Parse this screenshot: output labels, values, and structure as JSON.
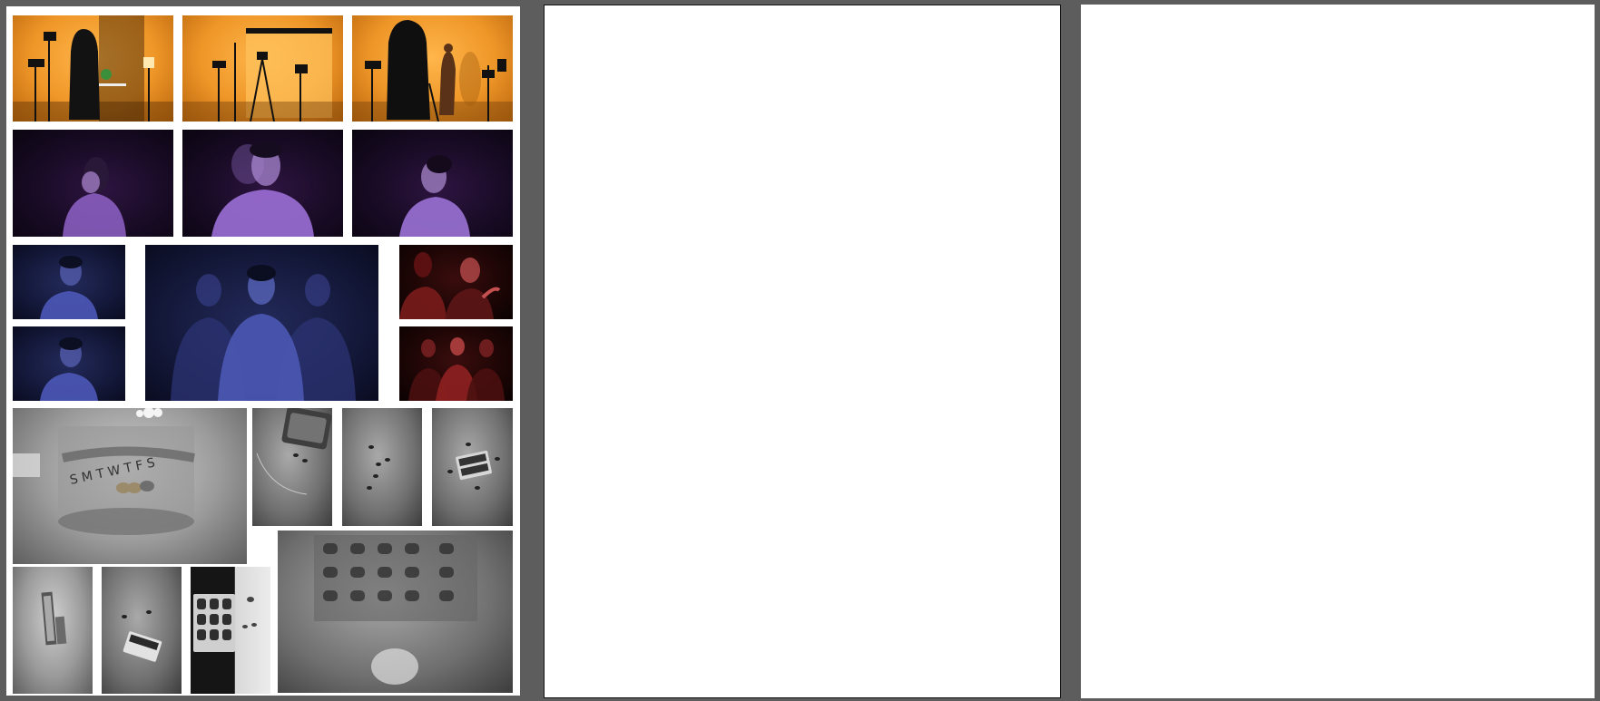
{
  "viewer": {
    "pages": [
      {
        "id": "page-1",
        "thumbnails": [
          {
            "name": "photo-studio-orange-1",
            "icon": "photo-icon"
          },
          {
            "name": "photo-studio-orange-2",
            "icon": "photo-icon"
          },
          {
            "name": "photo-studio-orange-3",
            "icon": "photo-icon"
          },
          {
            "name": "photo-portrait-purple-1",
            "icon": "photo-icon"
          },
          {
            "name": "photo-portrait-purple-2",
            "icon": "photo-icon"
          },
          {
            "name": "photo-portrait-purple-3",
            "icon": "photo-icon"
          },
          {
            "name": "photo-portrait-blue-small-1",
            "icon": "photo-icon"
          },
          {
            "name": "photo-portrait-blue-small-2",
            "icon": "photo-icon"
          },
          {
            "name": "photo-portrait-blue-triple",
            "icon": "photo-icon"
          },
          {
            "name": "photo-portrait-red-1",
            "icon": "photo-icon"
          },
          {
            "name": "photo-portrait-red-2",
            "icon": "photo-icon"
          },
          {
            "name": "photo-pill-organizer-large",
            "icon": "photo-icon"
          },
          {
            "name": "photo-pills-1",
            "icon": "photo-icon"
          },
          {
            "name": "photo-pills-2",
            "icon": "photo-icon"
          },
          {
            "name": "photo-pills-3",
            "icon": "photo-icon"
          },
          {
            "name": "photo-blister-pack-blur",
            "icon": "photo-icon"
          },
          {
            "name": "photo-pills-4",
            "icon": "photo-icon"
          },
          {
            "name": "photo-pills-5",
            "icon": "photo-icon"
          },
          {
            "name": "photo-pills-6",
            "icon": "photo-icon"
          }
        ]
      },
      {
        "id": "page-2",
        "thumbnails": []
      },
      {
        "id": "page-3",
        "thumbnails": []
      }
    ]
  },
  "colors": {
    "background": "#5d5d5d",
    "page": "#ffffff",
    "orange": "#ef9628",
    "purple": "#9b6fd6",
    "blue": "#4d58b8",
    "red": "#b02020"
  }
}
